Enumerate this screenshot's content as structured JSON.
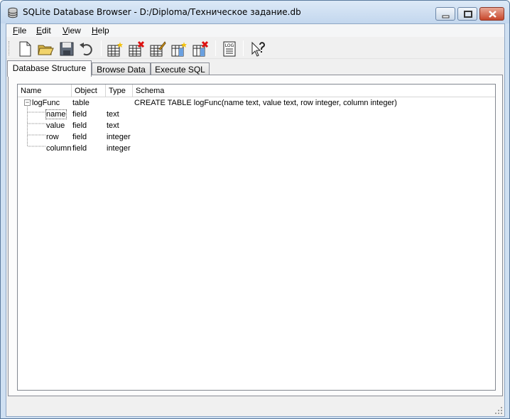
{
  "window": {
    "title": "SQLite Database Browser - D:/Diploma/Техническое задание.db",
    "icon": "database-icon"
  },
  "menu": {
    "items": [
      {
        "label": "File",
        "accel": "F",
        "rest": "ile"
      },
      {
        "label": "Edit",
        "accel": "E",
        "rest": "dit"
      },
      {
        "label": "View",
        "accel": "V",
        "rest": "iew"
      },
      {
        "label": "Help",
        "accel": "H",
        "rest": "elp"
      }
    ]
  },
  "toolbar": {
    "buttons": [
      "new-database-icon",
      "open-database-icon",
      "save-icon",
      "undo-icon",
      "create-table-icon",
      "delete-table-icon",
      "modify-table-icon",
      "create-index-icon",
      "delete-index-icon",
      "log-icon",
      "whats-this-icon"
    ],
    "log_label": "LOG"
  },
  "tabs": [
    {
      "label": "Database Structure",
      "active": true
    },
    {
      "label": "Browse Data",
      "active": false
    },
    {
      "label": "Execute SQL",
      "active": false
    }
  ],
  "tree": {
    "columns": [
      "Name",
      "Object",
      "Type",
      "Schema"
    ],
    "rows": [
      {
        "name": "logFunc",
        "object": "table",
        "type": "",
        "schema": "CREATE TABLE logFunc(name text, value text, row integer, column integer)"
      },
      {
        "name": "name",
        "object": "field",
        "type": "text",
        "schema": ""
      },
      {
        "name": "value",
        "object": "field",
        "type": "text",
        "schema": ""
      },
      {
        "name": "row",
        "object": "field",
        "type": "integer",
        "schema": ""
      },
      {
        "name": "column",
        "object": "field",
        "type": "integer",
        "schema": ""
      }
    ],
    "expander": "−"
  },
  "colors": {
    "titlebar": "#c3d7ee",
    "close_button": "#c7462b",
    "window_bg": "#f0f0f0"
  }
}
